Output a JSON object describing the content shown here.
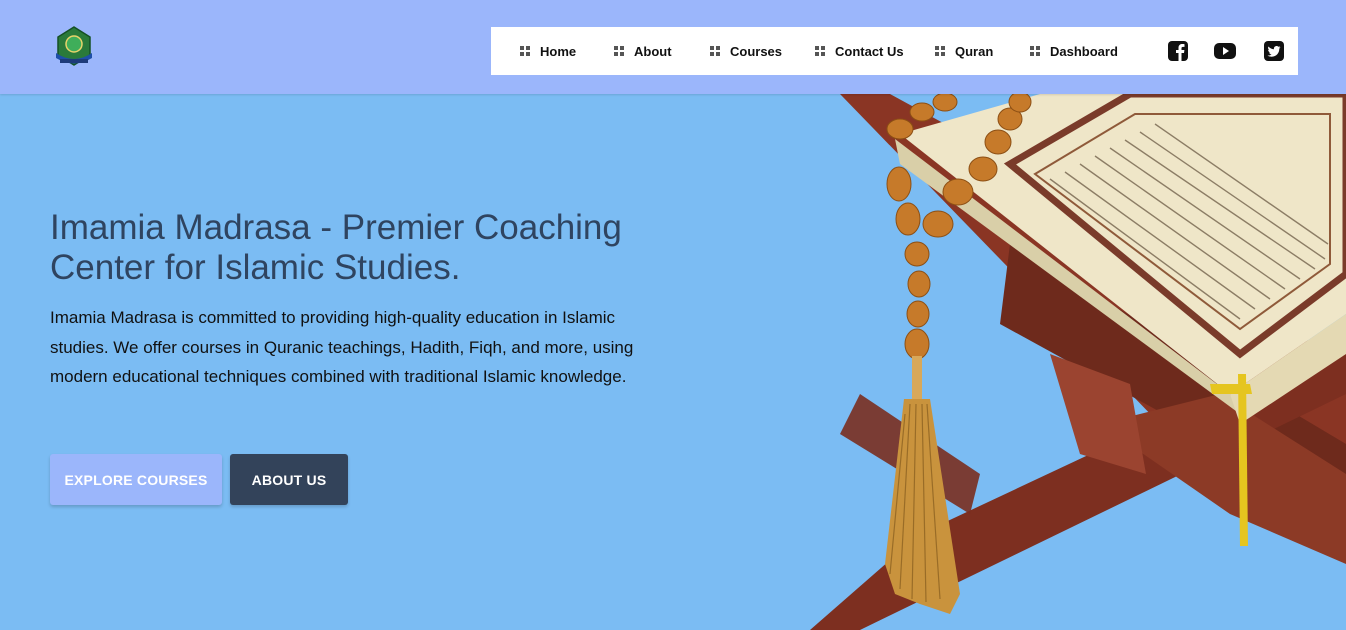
{
  "header": {
    "logo_icon": "madrasa-logo-icon",
    "nav": [
      {
        "label": "Home",
        "icon": "grid-icon"
      },
      {
        "label": "About",
        "icon": "grid-icon"
      },
      {
        "label": "Courses",
        "icon": "grid-icon"
      },
      {
        "label": "Contact Us",
        "icon": "grid-icon"
      },
      {
        "label": "Quran",
        "icon": "grid-icon"
      },
      {
        "label": "Dashboard",
        "icon": "grid-icon"
      }
    ],
    "social": [
      "facebook-icon",
      "youtube-icon",
      "twitter-icon"
    ]
  },
  "hero": {
    "title": "Imamia Madrasa - Premier Coaching Center for Islamic Studies.",
    "description": "Imamia Madrasa is committed to providing high-quality education in Islamic studies. We offer courses in Quranic teachings, Hadith, Fiqh, and more, using modern educational techniques combined with traditional Islamic knowledge.",
    "buttons": {
      "explore": "EXPLORE COURSES",
      "about": "ABOUT US"
    },
    "image": "quran-on-rehal-with-prayer-beads"
  },
  "colors": {
    "header_bg": "#9bb6fb",
    "page_bg": "#7bbcf3",
    "title": "#2f4460",
    "explore_button": "#9bb6fb",
    "about_button": "#33435a"
  }
}
